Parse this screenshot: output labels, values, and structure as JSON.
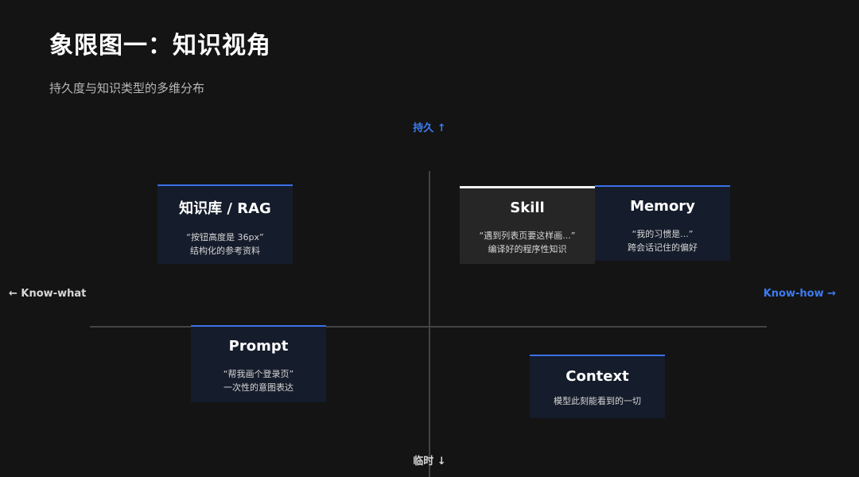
{
  "slide": {
    "title": "象限图一：知识视角",
    "subtitle": "持久度与知识类型的多维分布"
  },
  "axes": {
    "top": "持久 ↑",
    "bottom": "临时 ↓",
    "left": "← Know-what",
    "right": "Know-how →"
  },
  "colors": {
    "background": "#141414",
    "accent_blue": "#3a70e6",
    "card_bg": "#151c2b",
    "skill_bg": "#262626"
  },
  "cards": {
    "rag": {
      "name": "知识库 / RAG",
      "quote": "“按钮高度是 36px”",
      "desc": "结构化的参考资料"
    },
    "skill": {
      "name": "Skill",
      "quote": "“遇到列表页要这样画...”",
      "desc": "编译好的程序性知识"
    },
    "memory": {
      "name": "Memory",
      "quote": "“我的习惯是...”",
      "desc": "跨会话记住的偏好"
    },
    "prompt": {
      "name": "Prompt",
      "quote": "“帮我画个登录页”",
      "desc": "一次性的意图表达"
    },
    "context": {
      "name": "Context",
      "desc": "模型此刻能看到的一切"
    }
  }
}
